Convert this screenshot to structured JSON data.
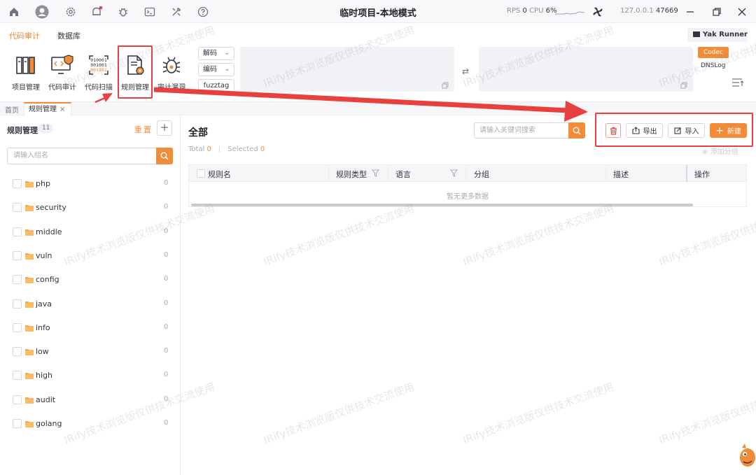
{
  "titlebar": {
    "title": "临时项目-本地模式",
    "rps_label": "RPS",
    "rps_value": "0",
    "cpu_label": "CPU",
    "cpu_value": "6%",
    "host": "127.0.0.1",
    "port": "47669"
  },
  "menu": {
    "tabs": [
      "代码审计",
      "数据库"
    ],
    "tools": [
      "项目管理",
      "代码审计",
      "代码扫描",
      "规则管理",
      "审计漏洞"
    ],
    "decode_label": "解码",
    "encode_label": "编码",
    "fuzztag_label": "fuzztag",
    "yak_runner": "Yak Runner",
    "codec": "Codec",
    "dnslog": "DNSLog"
  },
  "tabs": {
    "home": "首页",
    "active": "规则管理"
  },
  "left": {
    "title": "规则管理",
    "count": "11",
    "reset": "重置",
    "search_placeholder": "请输入组名",
    "groups": [
      {
        "name": "php",
        "count": "0"
      },
      {
        "name": "security",
        "count": "0"
      },
      {
        "name": "middle",
        "count": "0"
      },
      {
        "name": "vuln",
        "count": "0"
      },
      {
        "name": "config",
        "count": "0"
      },
      {
        "name": "java",
        "count": "0"
      },
      {
        "name": "info",
        "count": "0"
      },
      {
        "name": "low",
        "count": "0"
      },
      {
        "name": "high",
        "count": "0"
      },
      {
        "name": "audit",
        "count": "0"
      },
      {
        "name": "golang",
        "count": "0"
      }
    ]
  },
  "main": {
    "title": "全部",
    "total_label": "Total",
    "total_value": "0",
    "selected_label": "Selected",
    "selected_value": "0",
    "search_placeholder": "请输入关键词搜索",
    "export": "导出",
    "import": "导入",
    "new": "新建",
    "add_group": "添加分组",
    "columns": [
      "规则名",
      "规则类型",
      "语言",
      "分组",
      "描述",
      "操作"
    ],
    "empty_text": "暂无更多数据"
  },
  "watermark": "IRify技术浏览版仅供技术交流使用",
  "colors": {
    "accent": "#f28b38",
    "annotation": "#e8403f"
  }
}
